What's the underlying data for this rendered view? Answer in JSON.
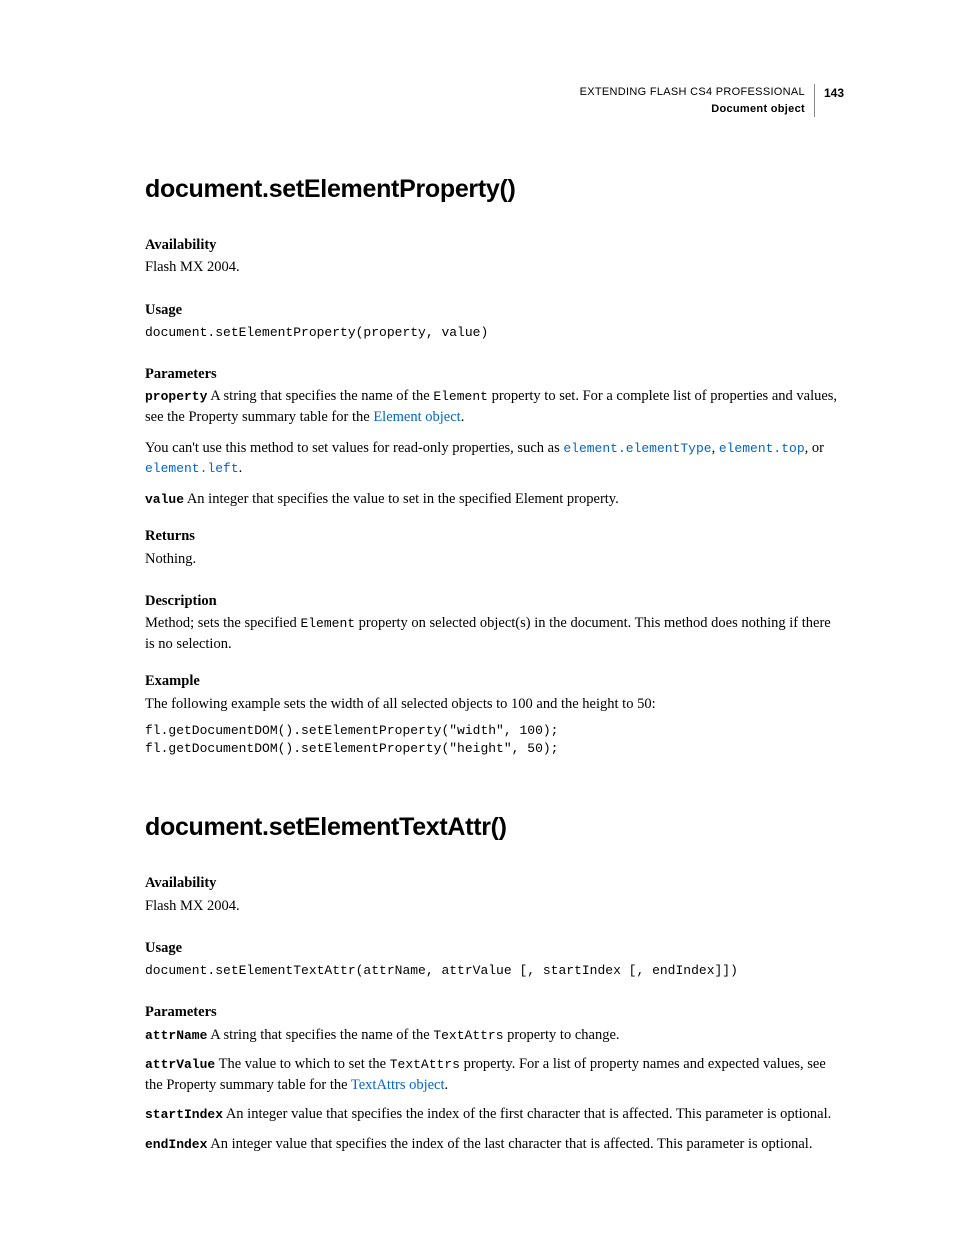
{
  "header": {
    "title": "EXTENDING FLASH CS4 PROFESSIONAL",
    "subtitle": "Document object",
    "page": "143"
  },
  "m1": {
    "title": "document.setElementProperty()",
    "availability_label": "Availability",
    "availability_text": "Flash MX 2004.",
    "usage_label": "Usage",
    "usage_code": "document.setElementProperty(property, value)",
    "parameters_label": "Parameters",
    "param_property_name": "property",
    "param_property_text_a": " A string that specifies the name of the ",
    "param_property_code": "Element",
    "param_property_text_b": " property to set. For a complete list of properties and values, see the Property summary table for the ",
    "param_property_link": "Element object",
    "param_property_text_c": ".",
    "readonly_text_a": "You can't use this method to set values for read-only properties, such as ",
    "readonly_link1": "element.elementType",
    "readonly_sep1": ", ",
    "readonly_link2": "element.top",
    "readonly_sep2": ", or ",
    "readonly_link3": "element.left",
    "readonly_text_c": ".",
    "param_value_name": "value",
    "param_value_text": " An integer that specifies the value to set in the specified Element property.",
    "returns_label": "Returns",
    "returns_text": "Nothing.",
    "description_label": "Description",
    "description_text_a": "Method; sets the specified ",
    "description_code": "Element",
    "description_text_b": " property on selected object(s) in the document. This method does nothing if there is no selection.",
    "example_label": "Example",
    "example_text": "The following example sets the width of all selected objects to 100 and the height to 50:",
    "example_code": "fl.getDocumentDOM().setElementProperty(\"width\", 100);\nfl.getDocumentDOM().setElementProperty(\"height\", 50);"
  },
  "m2": {
    "title": "document.setElementTextAttr()",
    "availability_label": "Availability",
    "availability_text": "Flash MX 2004.",
    "usage_label": "Usage",
    "usage_code": "document.setElementTextAttr(attrName, attrValue [, startIndex [, endIndex]])",
    "parameters_label": "Parameters",
    "p1_name": "attrName",
    "p1_text_a": " A string that specifies the name of the ",
    "p1_code": "TextAttrs",
    "p1_text_b": " property to change.",
    "p2_name": "attrValue",
    "p2_text_a": " The value to which to set the ",
    "p2_code": "TextAttrs",
    "p2_text_b": " property. For a list of property names and expected values, see the Property summary table for the ",
    "p2_link": "TextAttrs object",
    "p2_text_c": ".",
    "p3_name": "startIndex",
    "p3_text": " An integer value that specifies the index of the first character that is affected. This parameter is optional.",
    "p4_name": "endIndex",
    "p4_text": " An integer value that specifies the index of the last character that is affected. This parameter is optional."
  }
}
